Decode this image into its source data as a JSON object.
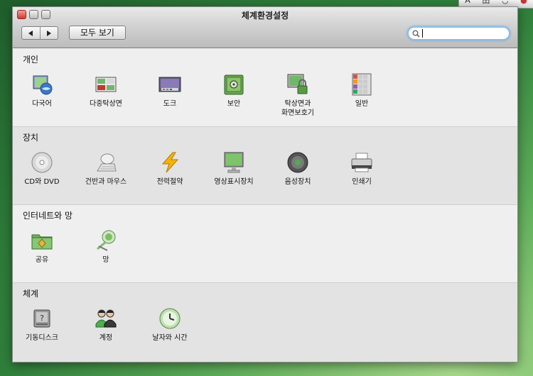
{
  "window": {
    "title": "체계환경설정",
    "show_all_label": "모두 보기",
    "search": {
      "value": "",
      "placeholder": ""
    }
  },
  "menu_extras": {
    "items": [
      "A",
      "田",
      "◡",
      "●"
    ]
  },
  "sections": [
    {
      "title": "개인",
      "items": [
        {
          "label": "다국어",
          "icon": "flag-globe-icon"
        },
        {
          "label": "다중탁상면",
          "icon": "spaces-icon"
        },
        {
          "label": "도크",
          "icon": "dock-icon"
        },
        {
          "label": "보안",
          "icon": "safe-icon"
        },
        {
          "label": "탁상면과\n화면보호기",
          "icon": "desktop-lock-icon"
        },
        {
          "label": "일반",
          "icon": "color-grid-icon"
        }
      ]
    },
    {
      "title": "장치",
      "items": [
        {
          "label": "CD와 DVD",
          "icon": "cd-icon"
        },
        {
          "label": "건반과 마우스",
          "icon": "keyboard-mouse-icon"
        },
        {
          "label": "전력절약",
          "icon": "lightning-icon"
        },
        {
          "label": "영상표시장치",
          "icon": "display-icon"
        },
        {
          "label": "음성장치",
          "icon": "speaker-icon"
        },
        {
          "label": "인쇄기",
          "icon": "printer-icon"
        }
      ]
    },
    {
      "title": "인터네트와 망",
      "items": [
        {
          "label": "공유",
          "icon": "sharing-folder-icon"
        },
        {
          "label": "망",
          "icon": "network-globe-icon"
        }
      ]
    },
    {
      "title": "체계",
      "items": [
        {
          "label": "기동디스크",
          "icon": "disk-icon"
        },
        {
          "label": "계정",
          "icon": "accounts-icon"
        },
        {
          "label": "날자와 시간",
          "icon": "clock-icon"
        }
      ]
    }
  ]
}
